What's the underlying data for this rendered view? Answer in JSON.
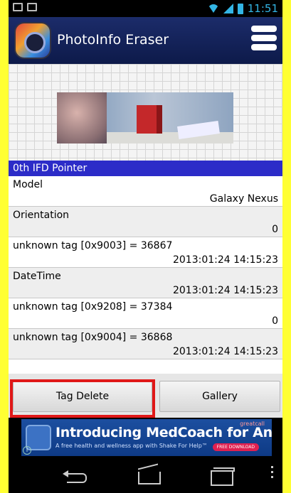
{
  "status_bar": {
    "time": "11:51"
  },
  "app": {
    "title": "PhotoInfo Eraser"
  },
  "section": {
    "header": "0th IFD Pointer"
  },
  "rows": [
    {
      "label": "Model",
      "value": "Galaxy Nexus"
    },
    {
      "label": "Orientation",
      "value": "0"
    },
    {
      "label": "unknown tag [0x9003] = 36867",
      "value": "2013:01:24 14:15:23"
    },
    {
      "label": "DateTime",
      "value": "2013:01:24 14:15:23"
    },
    {
      "label": "unknown tag [0x9208] = 37384",
      "value": "0"
    },
    {
      "label": "unknown tag [0x9004] = 36868",
      "value": "2013:01:24 14:15:23"
    }
  ],
  "buttons": {
    "tag_delete": "Tag Delete",
    "gallery": "Gallery"
  },
  "ad": {
    "headline": "Introducing MedCoach for Android",
    "subtext": "A free health and wellness app with Shake For Help™",
    "brand": "greatcall",
    "cta": "FREE DOWNLOAD"
  },
  "colors": {
    "background": "#ffff33",
    "action_bar": "#1c2c6a",
    "section_header": "#2c2cc8",
    "highlight": "#e01818"
  }
}
